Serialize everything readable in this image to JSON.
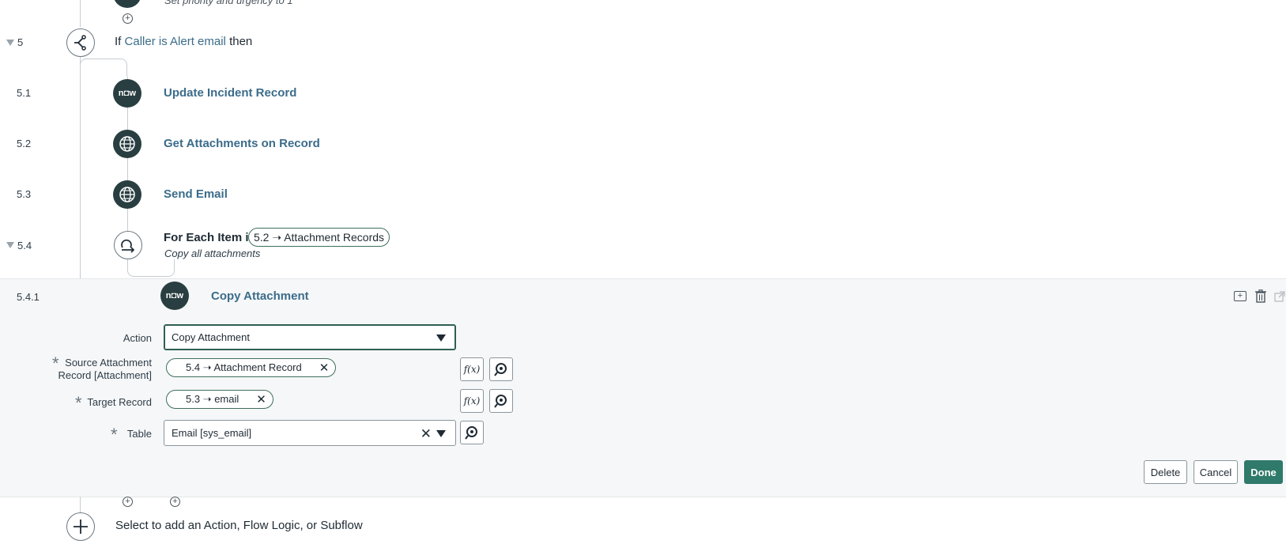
{
  "top_partial": {
    "description": "Set priority and urgency to 1"
  },
  "steps": [
    {
      "num": "5",
      "prefix": "If",
      "condition": "Caller is Alert email",
      "suffix": "then"
    },
    {
      "num": "5.1",
      "title": "Update Incident Record",
      "icon": "now-logo"
    },
    {
      "num": "5.2",
      "title": "Get Attachments on Record",
      "icon": "globe-icon"
    },
    {
      "num": "5.3",
      "title": "Send Email",
      "icon": "globe-icon"
    },
    {
      "num": "5.4",
      "title": "For Each Item in",
      "pill": "5.2 ➝ Attachment Records",
      "description": "Copy all attachments",
      "icon": "loop-icon"
    }
  ],
  "expanded": {
    "num": "5.4.1",
    "title": "Copy Attachment",
    "action_label": "Action",
    "action_value": "Copy Attachment",
    "source_label_line1": "Source Attachment",
    "source_label_line2": "Record [Attachment]",
    "source_pill": "5.4 ➝ Attachment Record",
    "target_label": "Target Record",
    "target_pill": "5.3 ➝ email",
    "table_label": "Table",
    "table_value": "Email [sys_email]",
    "fx_label": "f(x)",
    "buttons": {
      "delete": "Delete",
      "cancel": "Cancel",
      "done": "Done"
    }
  },
  "add_prompt": "Select to add an Action, Flow Logic, or Subflow",
  "colors": {
    "link": "#3b6c8a",
    "dark_icon": "#293e40",
    "done_button": "#2f7a6a",
    "panel_bg": "#f6f7f8"
  }
}
